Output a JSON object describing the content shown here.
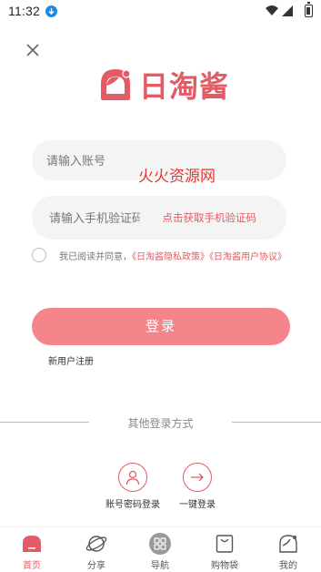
{
  "status_bar": {
    "time": "11:32",
    "icons": [
      "download-icon",
      "wifi-icon",
      "signal-icon",
      "battery-icon"
    ]
  },
  "header": {
    "close_icon": "close-icon",
    "logo_text": "日淘酱"
  },
  "login_form": {
    "account_placeholder": "请输入账号",
    "account_value": "",
    "watermark": "火火资源网",
    "phone_placeholder": "请输入手机验证码",
    "phone_value": "",
    "sms_link": "点击获取手机验证码",
    "agreement": {
      "prefix": "我已阅读并同意，",
      "privacy_policy": "《日淘酱隐私政策》",
      "user_agreement": "《日淘酱用户协议》",
      "checked": false
    },
    "login_button": "登录",
    "register_link": "新用户注册"
  },
  "other_login": {
    "title": "其他登录方式",
    "options": [
      {
        "label": "账号密码登录",
        "icon": "user-icon"
      },
      {
        "label": "一键登录",
        "icon": "arrow-right-icon"
      }
    ]
  },
  "tab_bar": {
    "items": [
      {
        "label": "首页",
        "icon": "home-icon",
        "active": true
      },
      {
        "label": "分享",
        "icon": "planet-icon",
        "active": false
      },
      {
        "label": "导航",
        "icon": "grid-icon",
        "active": false
      },
      {
        "label": "购物袋",
        "icon": "bag-icon",
        "active": false
      },
      {
        "label": "我的",
        "icon": "profile-icon",
        "active": false
      }
    ]
  },
  "colors": {
    "brand": "#e35b64",
    "button": "#f4858b",
    "watermark": "#e53935"
  }
}
